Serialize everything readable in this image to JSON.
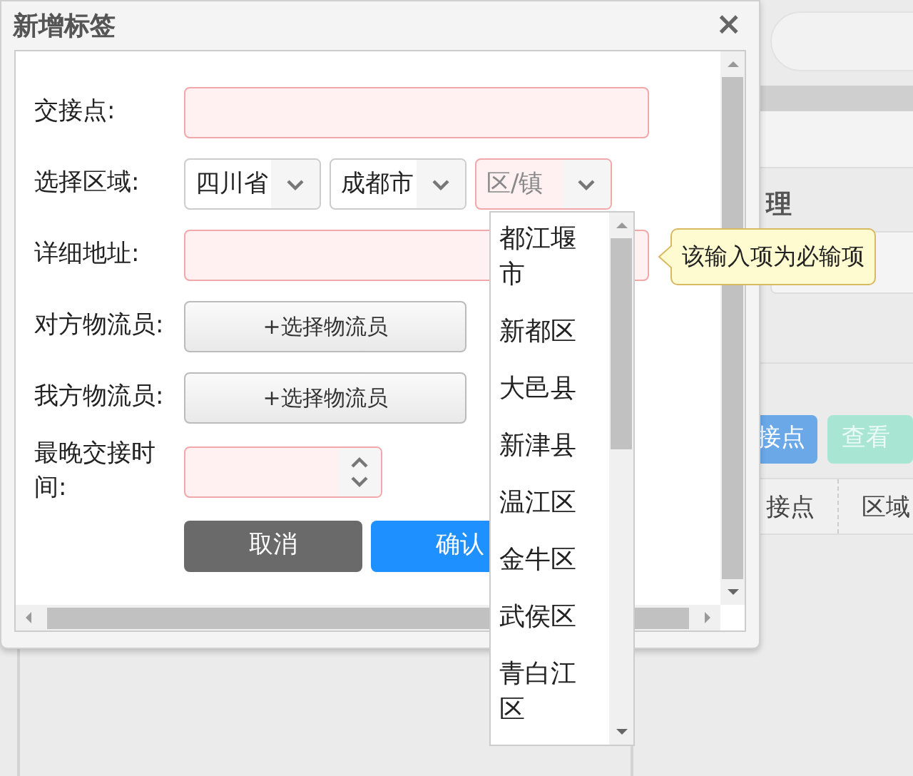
{
  "dialog": {
    "title": "新增标签",
    "close": "×",
    "fields": [
      {
        "kind": "text",
        "label": "交接点:",
        "invalid": true
      },
      {
        "kind": "region",
        "label": "选择区域:",
        "selects": [
          {
            "value": "四川省",
            "invalid": false
          },
          {
            "value": "成都市",
            "invalid": false
          },
          {
            "placeholder": "区/镇",
            "invalid": true
          }
        ]
      },
      {
        "kind": "text",
        "label": "详细地址:",
        "invalid": true
      },
      {
        "kind": "picker",
        "label": "对方物流员:",
        "button": "+选择物流员"
      },
      {
        "kind": "picker",
        "label": "我方物流员:",
        "button": "+选择物流员"
      },
      {
        "kind": "spinner",
        "label": "最晚交接时间:",
        "invalid": true
      }
    ],
    "buttons": [
      {
        "kind": "cancel",
        "label": "取消"
      },
      {
        "kind": "confirm",
        "label": "确认"
      }
    ]
  },
  "dropdown": {
    "items": [
      "都江堰市",
      "新都区",
      "大邑县",
      "新津县",
      "温江区",
      "金牛区",
      "武侯区",
      "青白江区"
    ]
  },
  "tooltip": "该输入项为必输项",
  "background": {
    "heading": "理",
    "buttons": [
      {
        "kind": "primary",
        "label": "接点"
      },
      {
        "kind": "secondary",
        "label": "查看"
      }
    ],
    "columns": [
      "接点",
      "区域"
    ]
  }
}
